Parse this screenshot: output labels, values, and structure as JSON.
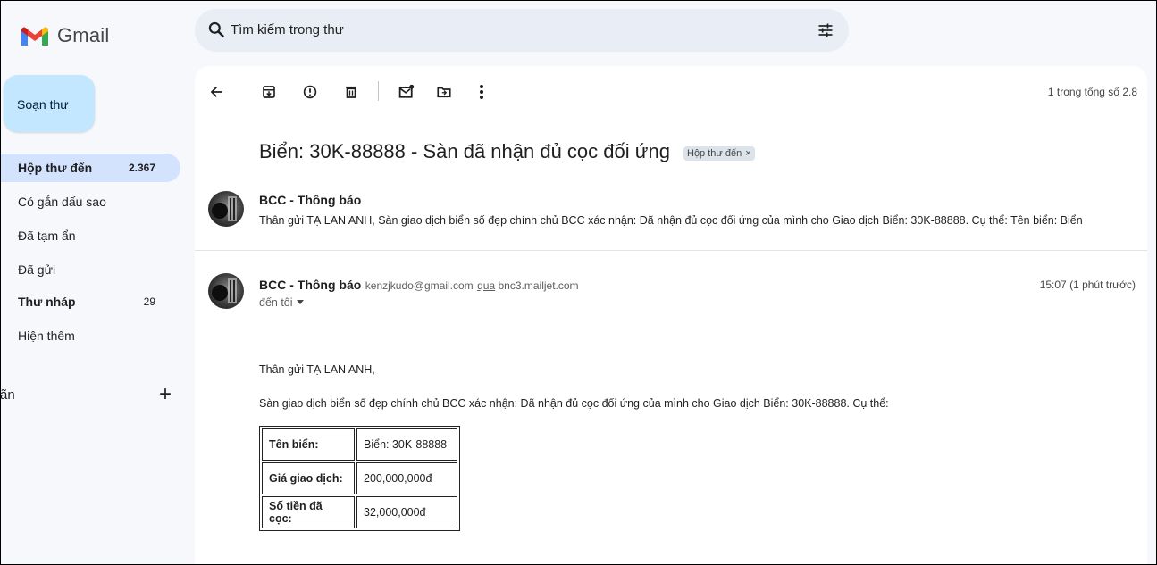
{
  "app": {
    "logo_text": "Gmail",
    "search_placeholder": "Tìm kiếm trong thư"
  },
  "sidebar": {
    "compose_label": "Soạn thư",
    "items": [
      {
        "label": "Hộp thư đến",
        "count": "2.367",
        "active": true
      },
      {
        "label": "Có gắn dấu sao",
        "count": ""
      },
      {
        "label": "Đã tạm ẩn",
        "count": ""
      },
      {
        "label": "Đã gửi",
        "count": ""
      },
      {
        "label": "Thư nháp",
        "count": "29",
        "bold": true
      },
      {
        "label": "Hiện thêm",
        "count": ""
      }
    ],
    "labels_heading": "ãn"
  },
  "toolbar": {
    "icons": [
      "back-arrow-icon",
      "archive-icon",
      "report-spam-icon",
      "delete-icon",
      "mark-unread-icon",
      "move-to-icon",
      "more-vert-icon"
    ],
    "pager_text": "1 trong tổng số 2.8"
  },
  "thread": {
    "subject": "Biển: 30K-88888 - Sàn đã nhận đủ cọc đối ứng",
    "label_chip": "Hộp thư đến",
    "chip_close": "×"
  },
  "collapsed_message": {
    "sender": "BCC - Thông báo",
    "snippet": "Thân gửi TẠ LAN ANH, Sàn giao dịch biển số đẹp chính chủ BCC xác nhận: Đã nhận đủ cọc đối ứng của mình cho Giao dịch Biển: 30K-88888. Cụ thể: Tên biển: Biển"
  },
  "open_message": {
    "sender": "BCC - Thông báo",
    "email": "kenzjkudo@gmail.com",
    "via_word": "qua",
    "via_domain": "bnc3.mailjet.com",
    "to": "đến tôi",
    "time": "15:07 (1 phút trước)",
    "greeting": "Thân gửi TẠ LAN ANH,",
    "paragraph": "Sàn giao dịch biển số đẹp chính chủ BCC xác nhận: Đã nhận đủ cọc đối ứng của mình cho Giao dịch Biển: 30K-88888. Cụ thể:",
    "table": [
      {
        "key": "Tên biển:",
        "value": "Biển: 30K-88888"
      },
      {
        "key": "Giá giao dịch:",
        "value": "200,000,000đ"
      },
      {
        "key": "Số tiền đã cọc:",
        "value": "32,000,000đ"
      }
    ]
  },
  "colors": {
    "background": "#f6f8fc",
    "compose": "#c2e7ff",
    "active_nav": "#d3e3fd",
    "search_bg": "#e9eef6",
    "gmail_red": "#ea4335",
    "gmail_blue": "#4285f4",
    "gmail_green": "#34a853",
    "gmail_yellow": "#fbbc04"
  }
}
